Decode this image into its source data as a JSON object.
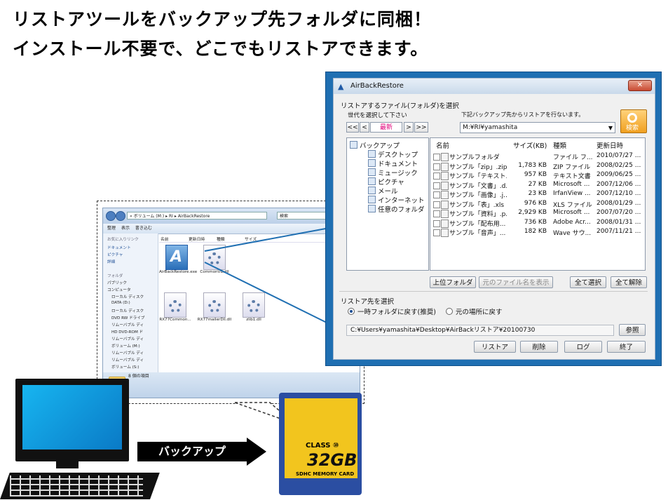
{
  "headline": {
    "line1": "リストアツールをバックアップ先フォルダに同梱！",
    "line2": "インストール不要で、どこでもリストアできます。"
  },
  "explorer": {
    "address": "« ボリューム (M:) ▸ RI ▸ AirBackRestore",
    "search_placeholder": "検索",
    "toolbar": [
      "整理",
      "表示",
      "書き込む"
    ],
    "left_links_title": "お気に入りリンク",
    "left_links": [
      "ドキュメント",
      "ピクチャ",
      "詳細"
    ],
    "folder_title": "フォルダ",
    "folders": [
      "パブリック",
      "コンピュータ",
      "ローカル ディスク",
      "DATA (D:)",
      "ローカル ディスク",
      "DVD RW ドライブ",
      "リムーバブル ディ",
      "HD DVD-ROM ド",
      "リムーバブル ディ",
      "ボリューム (M:)",
      "リムーバブル ディ",
      "リムーバブル ディ",
      "ボリューム (S:)"
    ],
    "columns": [
      "名前",
      "更新日時",
      "種類",
      "サイズ"
    ],
    "files": [
      {
        "name": "AirBackRestore.exe",
        "kind": "app"
      },
      {
        "name": "CommonVB.dll",
        "kind": "gear"
      },
      {
        "name": "RX77Common...",
        "kind": "gear"
      },
      {
        "name": "RX77mailerDll.dll",
        "kind": "gear"
      },
      {
        "name": "zlib1.dll",
        "kind": "gear"
      }
    ],
    "status": "8 個の項目"
  },
  "dialog": {
    "title": "AirBackRestore",
    "close": "✕",
    "section_select": "リストアするファイル(フォルダ)を選択",
    "generation_label": "世代を選択して下さい",
    "nav": {
      "first": "<<",
      "prev": "<",
      "current": "最新",
      "next": ">",
      "last": ">>"
    },
    "source_label": "下記バックアップ先からリストアを行ないます。",
    "source_value": "M:¥RI¥yamashita",
    "search_label": "検索",
    "tree": [
      "バックアップ",
      "デスクトップ",
      "ドキュメント",
      "ミュージック",
      "ピクチャ",
      "メール",
      "インターネット",
      "任意のフォルダ"
    ],
    "list_headers": {
      "name": "名前",
      "size": "サイズ(KB)",
      "type": "種類",
      "date": "更新日時"
    },
    "rows": [
      {
        "name": "サンプルフォルダ",
        "size": "",
        "type": "ファイル フ...",
        "date": "2010/07/27 ..."
      },
      {
        "name": "サンプル「zip」.zip",
        "size": "1,783 KB",
        "type": "ZIP ファイル",
        "date": "2008/02/25 ..."
      },
      {
        "name": "サンプル「テキスト...",
        "size": "957 KB",
        "type": "テキスト文書",
        "date": "2009/06/25 ..."
      },
      {
        "name": "サンプル「文書」.d...",
        "size": "27 KB",
        "type": "Microsoft ...",
        "date": "2007/12/06 ..."
      },
      {
        "name": "サンプル「画像」.j...",
        "size": "23 KB",
        "type": "IrfanView ...",
        "date": "2007/12/10 ..."
      },
      {
        "name": "サンプル「表」.xls",
        "size": "976 KB",
        "type": "XLS ファイル",
        "date": "2008/01/29 ..."
      },
      {
        "name": "サンプル「資料」.p...",
        "size": "2,929 KB",
        "type": "Microsoft ...",
        "date": "2007/07/20 ..."
      },
      {
        "name": "サンプル「配布用...",
        "size": "736 KB",
        "type": "Adobe Acr...",
        "date": "2008/01/31 ..."
      },
      {
        "name": "サンプル「音声」...",
        "size": "182 KB",
        "type": "Wave サウ...",
        "date": "2007/11/21 ..."
      }
    ],
    "btn_parent": "上位フォルダ",
    "btn_showname": "元のファイル名を表示",
    "btn_selectall": "全て選択",
    "btn_clearall": "全て解除",
    "section_dest": "リストア先を選択",
    "radio_temp": "一時フォルダに戻す(推奨)",
    "radio_orig": "元の場所に戻す",
    "dest_path": "C:¥Users¥yamashita¥Desktop¥AirBackリストア¥20100730",
    "btn_browse": "参照",
    "btn_restore": "リストア",
    "btn_delete": "削除",
    "btn_log": "ログ",
    "btn_exit": "終了"
  },
  "bottom": {
    "arrow_label": "バックアップ",
    "sd_class": "CLASS ⑩",
    "sd_capacity": "32GB",
    "sd_subtitle": "SDHC MEMORY CARD"
  }
}
